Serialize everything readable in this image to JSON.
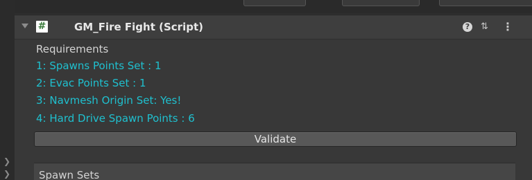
{
  "component": {
    "title": "GM_Fire Fight (Script)",
    "script_icon": "#",
    "help_icon": "?",
    "preset_icon": "⇅",
    "menu_icon": "⋮"
  },
  "requirements": {
    "label": "Requirements",
    "items": [
      "1: Spawns Points Set : 1",
      "2: Evac Points Set : 1",
      "3: Navmesh Origin Set: Yes!",
      "4: Hard Drive Spawn Points : 6"
    ]
  },
  "validate_button": {
    "label": "Validate"
  },
  "spawn_sets": {
    "label": "Spawn Sets"
  },
  "colors": {
    "requirement_text": "#1fc0cf",
    "background": "#383838"
  }
}
